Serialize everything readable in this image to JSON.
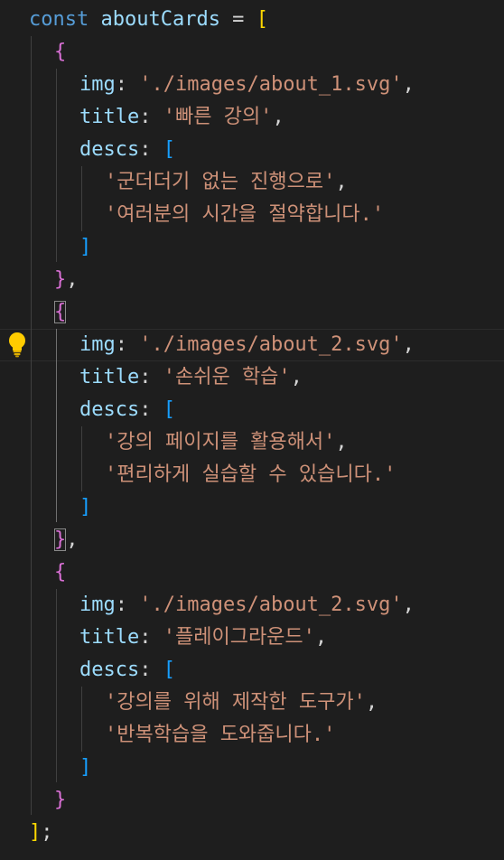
{
  "editor": {
    "lines": [
      {
        "indent": 0,
        "tokens": [
          {
            "t": "const ",
            "c": "kw"
          },
          {
            "t": "aboutCards",
            "c": "var"
          },
          {
            "t": " = ",
            "c": "op"
          },
          {
            "t": "[",
            "c": "b1"
          }
        ]
      },
      {
        "indent": 1,
        "tokens": [
          {
            "t": "{",
            "c": "b2"
          }
        ]
      },
      {
        "indent": 2,
        "tokens": [
          {
            "t": "img",
            "c": "prop"
          },
          {
            "t": ": ",
            "c": "op"
          },
          {
            "t": "'./images/about_1.svg'",
            "c": "str"
          },
          {
            "t": ",",
            "c": "pun"
          }
        ]
      },
      {
        "indent": 2,
        "tokens": [
          {
            "t": "title",
            "c": "prop"
          },
          {
            "t": ": ",
            "c": "op"
          },
          {
            "t": "'빠른 강의'",
            "c": "str"
          },
          {
            "t": ",",
            "c": "pun"
          }
        ]
      },
      {
        "indent": 2,
        "tokens": [
          {
            "t": "descs",
            "c": "prop"
          },
          {
            "t": ": ",
            "c": "op"
          },
          {
            "t": "[",
            "c": "b3"
          }
        ]
      },
      {
        "indent": 3,
        "tokens": [
          {
            "t": "'군더더기 없는 진행으로'",
            "c": "str"
          },
          {
            "t": ",",
            "c": "pun"
          }
        ]
      },
      {
        "indent": 3,
        "tokens": [
          {
            "t": "'여러분의 시간을 절약합니다.'",
            "c": "str"
          }
        ]
      },
      {
        "indent": 2,
        "tokens": [
          {
            "t": "]",
            "c": "b3"
          }
        ]
      },
      {
        "indent": 1,
        "tokens": [
          {
            "t": "}",
            "c": "b2"
          },
          {
            "t": ",",
            "c": "pun"
          }
        ]
      },
      {
        "indent": 1,
        "tokens": [
          {
            "t": "{",
            "c": "b2",
            "match": true
          }
        ]
      },
      {
        "indent": 2,
        "tokens": [
          {
            "t": "img",
            "c": "prop"
          },
          {
            "t": ": ",
            "c": "op"
          },
          {
            "t": "'./images/about_2.svg'",
            "c": "str"
          },
          {
            "t": ",",
            "c": "pun"
          }
        ]
      },
      {
        "indent": 2,
        "tokens": [
          {
            "t": "title",
            "c": "prop"
          },
          {
            "t": ": ",
            "c": "op"
          },
          {
            "t": "'손쉬운 학습'",
            "c": "str"
          },
          {
            "t": ",",
            "c": "pun"
          }
        ]
      },
      {
        "indent": 2,
        "tokens": [
          {
            "t": "descs",
            "c": "prop"
          },
          {
            "t": ": ",
            "c": "op"
          },
          {
            "t": "[",
            "c": "b3"
          }
        ]
      },
      {
        "indent": 3,
        "tokens": [
          {
            "t": "'강의 페이지를 활용해서'",
            "c": "str"
          },
          {
            "t": ",",
            "c": "pun"
          }
        ]
      },
      {
        "indent": 3,
        "tokens": [
          {
            "t": "'편리하게 실습할 수 있습니다.'",
            "c": "str"
          }
        ]
      },
      {
        "indent": 2,
        "tokens": [
          {
            "t": "]",
            "c": "b3"
          }
        ]
      },
      {
        "indent": 1,
        "tokens": [
          {
            "t": "}",
            "c": "b2",
            "match": true
          },
          {
            "t": ",",
            "c": "pun"
          }
        ]
      },
      {
        "indent": 1,
        "tokens": [
          {
            "t": "{",
            "c": "b2"
          }
        ]
      },
      {
        "indent": 2,
        "tokens": [
          {
            "t": "img",
            "c": "prop"
          },
          {
            "t": ": ",
            "c": "op"
          },
          {
            "t": "'./images/about_2.svg'",
            "c": "str"
          },
          {
            "t": ",",
            "c": "pun"
          }
        ]
      },
      {
        "indent": 2,
        "tokens": [
          {
            "t": "title",
            "c": "prop"
          },
          {
            "t": ": ",
            "c": "op"
          },
          {
            "t": "'플레이그라운드'",
            "c": "str"
          },
          {
            "t": ",",
            "c": "pun"
          }
        ]
      },
      {
        "indent": 2,
        "tokens": [
          {
            "t": "descs",
            "c": "prop"
          },
          {
            "t": ": ",
            "c": "op"
          },
          {
            "t": "[",
            "c": "b3"
          }
        ]
      },
      {
        "indent": 3,
        "tokens": [
          {
            "t": "'강의를 위해 제작한 도구가'",
            "c": "str"
          },
          {
            "t": ",",
            "c": "pun"
          }
        ]
      },
      {
        "indent": 3,
        "tokens": [
          {
            "t": "'반복학습을 도와줍니다.'",
            "c": "str"
          }
        ]
      },
      {
        "indent": 2,
        "tokens": [
          {
            "t": "]",
            "c": "b3"
          }
        ]
      },
      {
        "indent": 1,
        "tokens": [
          {
            "t": "}",
            "c": "b2"
          }
        ]
      },
      {
        "indent": 0,
        "tokens": [
          {
            "t": "]",
            "c": "b1"
          },
          {
            "t": ";",
            "c": "pun"
          }
        ]
      }
    ],
    "lightbulb_icon": "lightbulb-icon",
    "colors": {
      "background": "#1e1e1e",
      "keyword": "#569cd6",
      "variable": "#9cdcfe",
      "string": "#ce9178",
      "bracket_level1": "#ffd700",
      "bracket_level2": "#da70d6",
      "bracket_level3": "#179fff"
    }
  }
}
